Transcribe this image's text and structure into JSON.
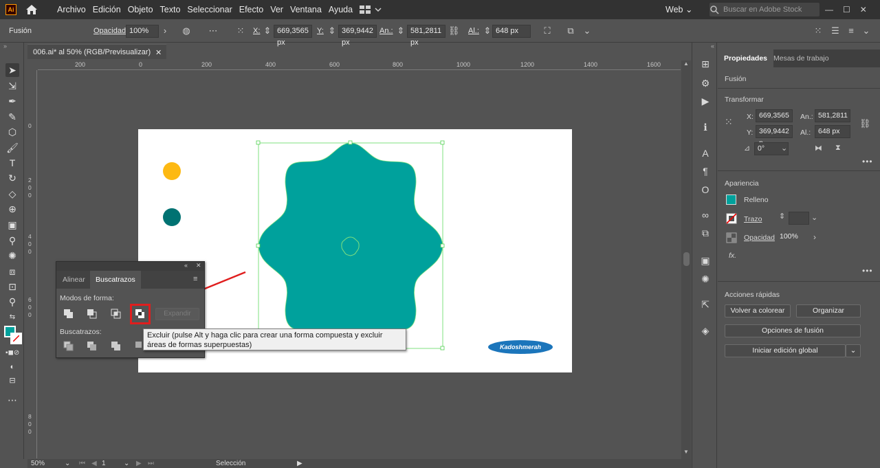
{
  "app": {
    "logo": "Ai",
    "menu": [
      "Archivo",
      "Edición",
      "Objeto",
      "Texto",
      "Seleccionar",
      "Efecto",
      "Ver",
      "Ventana",
      "Ayuda"
    ],
    "workspace": "Web",
    "stock_search_placeholder": "Buscar en Adobe Stock"
  },
  "control_bar": {
    "object_type": "Fusión",
    "opacity_label": "Opacidad:",
    "opacity_value": "100%",
    "x_label": "X:",
    "x_value": "669,3565 px",
    "y_label": "Y:",
    "y_value": "369,9442 px",
    "w_label": "An.:",
    "w_value": "581,2811 px",
    "h_label": "Al.:",
    "h_value": "648 px"
  },
  "document": {
    "tab_title": "006.ai* al 50% (RGB/Previsualizar)",
    "close": "✕",
    "ruler_h": [
      "200",
      "0",
      "200",
      "400",
      "600",
      "800",
      "1000",
      "1200",
      "1400",
      "1600"
    ],
    "ruler_v": [
      [
        "0"
      ],
      [
        "2",
        "0",
        "0"
      ],
      [
        "4",
        "0",
        "0"
      ],
      [
        "6",
        "0",
        "0"
      ],
      [
        "8",
        "0",
        "0"
      ]
    ],
    "watermark": "Kadoshmerah",
    "colors": {
      "teal": "#00a19c",
      "dark_teal": "#007272",
      "yellow": "#fdb913",
      "badge": "#1b75bb"
    }
  },
  "pathfinder": {
    "tabs": [
      "Alinear",
      "Buscatrazos"
    ],
    "active_tab": "Buscatrazos",
    "shape_modes_label": "Modos de forma:",
    "expand_label": "Expandir",
    "pathfinders_label": "Buscatrazos:",
    "tooltip": "Excluir (pulse Alt y haga clic para crear una forma compuesta y excluir áreas de formas superpuestas)"
  },
  "status": {
    "zoom": "50%",
    "artboard": "1",
    "tool": "Selección"
  },
  "properties": {
    "tabs": [
      "Propiedades",
      "Mesas de trabajo"
    ],
    "object_type": "Fusión",
    "transform_title": "Transformar",
    "x_label": "X:",
    "x_value": "669,3565 p",
    "y_label": "Y:",
    "y_value": "369,9442 p",
    "w_label": "An.:",
    "w_value": "581,2811 p",
    "h_label": "Al.:",
    "h_value": "648 px",
    "angle_value": "0°",
    "appearance_title": "Apariencia",
    "fill_label": "Relleno",
    "stroke_label": "Trazo",
    "opacity_label": "Opacidad",
    "opacity_value": "100%",
    "fx_label": "fx.",
    "quick_actions_title": "Acciones rápidas",
    "recolor_button": "Volver a colorear",
    "arrange_button": "Organizar",
    "blend_options_button": "Opciones de fusión",
    "global_edit_button": "Iniciar edición global"
  }
}
